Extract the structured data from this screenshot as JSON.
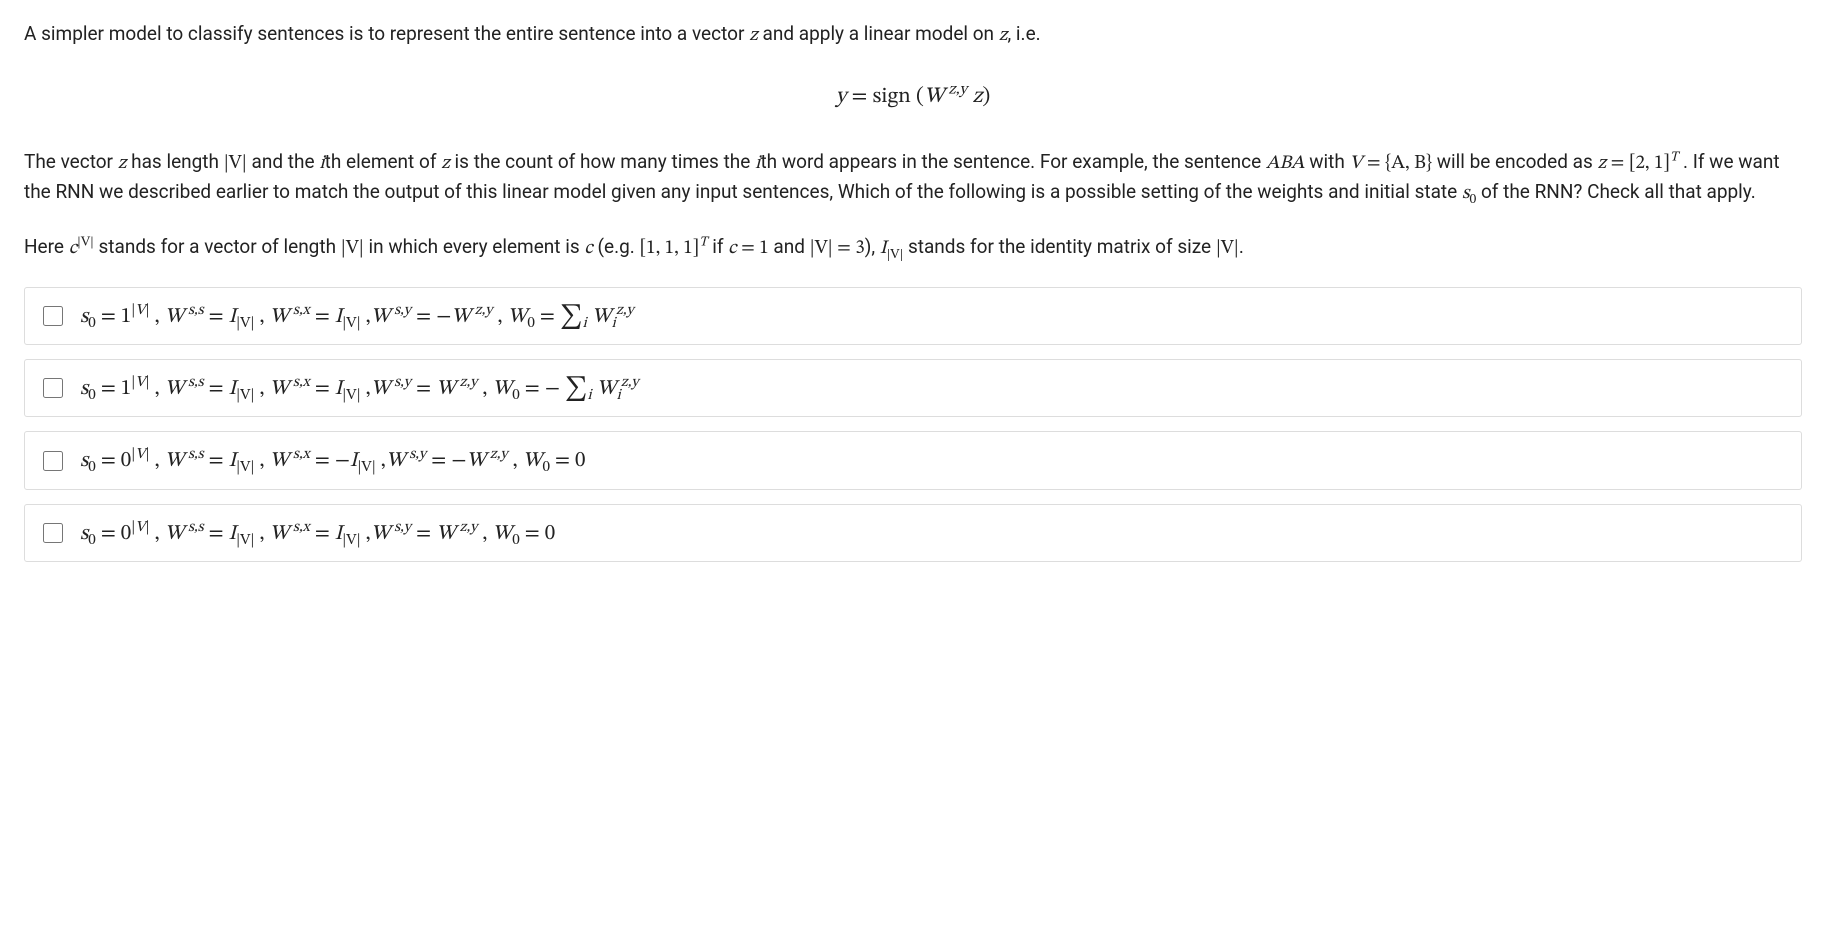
{
  "intro": {
    "pre": "A simpler model to classify sentences is to represent the entire sentence into a vector ",
    "var_z": "z",
    "mid": " and apply a linear model on ",
    "var_z2": "z",
    "post": ", i.e."
  },
  "center_eq": {
    "lhs": "y",
    "eq": " = ",
    "fn": "sign",
    "open": " (",
    "W": "W",
    "sup": " z,y",
    "arg": " z",
    "close": ")"
  },
  "para2": {
    "t1": "The vector ",
    "z": "z",
    "t2": " has length ",
    "absV": "|V|",
    "t3": " and the ",
    "i1": "i",
    "t4": "th element of ",
    "z2": "z",
    "t5": " is the count of how many times the ",
    "i2": "i",
    "t6": "th word appears in the sentence. For example, the sentence ",
    "ABA": "ABA",
    "t7": " with ",
    "V": "V",
    "eq": " = ",
    "set": "{A, B}",
    "t8": " will be encoded as ",
    "z3": "z",
    "eq2": " = ",
    "vec": "[2, 1]",
    "Tsup": "T",
    "t9": " . If we want the RNN we described earlier to match the output of this linear model given any input sentences, Which of the following is a possible setting of the weights and initial state ",
    "s0": "s",
    "s0sub": "0",
    "t10": " of the RNN? Check all that apply."
  },
  "para3": {
    "t1": "Here ",
    "c": "c",
    "csup": "|V|",
    "t2": " stands for a vector of length ",
    "absV": "|V|",
    "t3": " in which every element is ",
    "c2": "c",
    "t4": " (e.g. ",
    "vec": "[1, 1, 1]",
    "Tsup": "T",
    "t5": " if ",
    "c3": "c",
    "eq": " = ",
    "one": "1",
    "t6": " and ",
    "absV2": "|V|",
    "eq2": " = ",
    "three": "3",
    "t7": "), ",
    "I": "I",
    "Isub": "|V|",
    "t8": " stands for the identity matrix of size ",
    "absV3": "|V|",
    "t9": "."
  },
  "choices": [
    {
      "id": "opt1",
      "s0_base": "1",
      "Wss": "I",
      "Wss_sub": "|V|",
      "Wsx": "I",
      "Wsx_sub": "|V|",
      "Wsx_sign": "",
      "Wsy_sign": "−",
      "Wsy": "W",
      "Wsy_sup": " z,y",
      "W0_pre": "",
      "W0_sum": "∑",
      "W0_sub": "i",
      "W0_W": "W",
      "W0_i": "i",
      "W0_sup": "z,y"
    },
    {
      "id": "opt2",
      "s0_base": "1",
      "Wss": "I",
      "Wss_sub": "|V|",
      "Wsx": "I",
      "Wsx_sub": "|V|",
      "Wsx_sign": "",
      "Wsy_sign": "",
      "Wsy": "W",
      "Wsy_sup": " z,y",
      "W0_pre": "− ",
      "W0_sum": "∑",
      "W0_sub": "i",
      "W0_W": "W",
      "W0_i": "i",
      "W0_sup": "z,y"
    },
    {
      "id": "opt3",
      "s0_base": "0",
      "Wss": "I",
      "Wss_sub": "|V|",
      "Wsx": "I",
      "Wsx_sub": "|V|",
      "Wsx_sign": "−",
      "Wsy_sign": "−",
      "Wsy": "W",
      "Wsy_sup": " z,y",
      "W0_pre": "",
      "W0_sum": "",
      "W0_sub": "",
      "W0_W": "0",
      "W0_i": "",
      "W0_sup": ""
    },
    {
      "id": "opt4",
      "s0_base": "0",
      "Wss": "I",
      "Wss_sub": "|V|",
      "Wsx": "I",
      "Wsx_sub": "|V|",
      "Wsx_sign": "",
      "Wsy_sign": "",
      "Wsy": "W",
      "Wsy_sup": " z,y",
      "W0_pre": "",
      "W0_sum": "",
      "W0_sub": "",
      "W0_W": "0",
      "W0_i": "",
      "W0_sup": ""
    }
  ]
}
